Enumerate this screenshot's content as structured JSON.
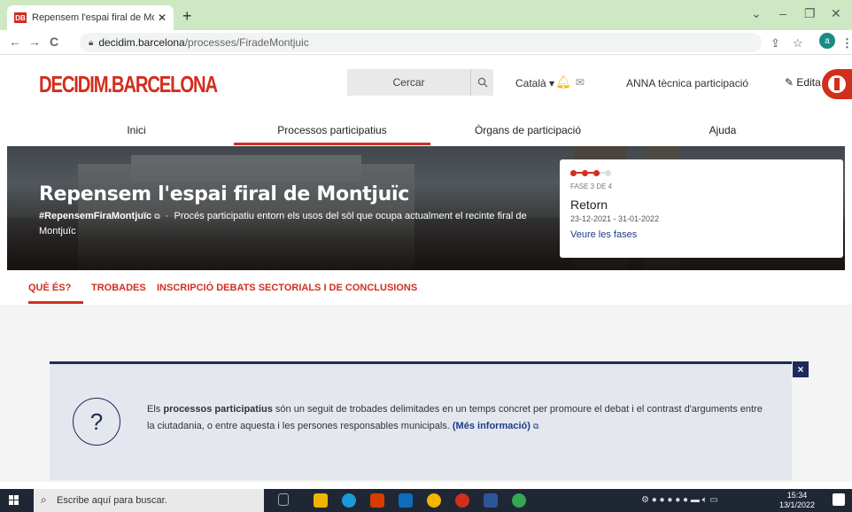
{
  "browser": {
    "tab_title": "Repensem l'espai firal de Montju",
    "tab_favicon": "DB",
    "url_host": "decidim.barcelona",
    "url_path": "/processes/FiradeMontjuic",
    "profile_initial": "a"
  },
  "header": {
    "logo": "DECIDIM.BARCELONA",
    "search_placeholder": "Cercar",
    "language": "Català",
    "user": "ANNA tècnica participació",
    "edit_label": "Edita"
  },
  "nav": {
    "items": [
      "Inici",
      "Processos participatius",
      "Òrgans de participació",
      "Ajuda"
    ],
    "active_index": 1
  },
  "hero": {
    "title": "Repensem l'espai firal de Montjuïc",
    "hashtag": "#RepensemFiraMontjuïc",
    "description": "Procés participatiu entorn els usos del sòl que ocupa actualment el recinte firal de Montjuïc"
  },
  "phase": {
    "step": "FASE 3 DE 4",
    "current": 3,
    "total": 4,
    "name": "Retorn",
    "dates": "23-12-2021 - 31-01-2022",
    "link": "Veure les fases"
  },
  "subnav": {
    "items": [
      "QUÈ ÉS?",
      "TROBADES",
      "INSCRIPCIÓ DEBATS SECTORIALS I DE CONCLUSIONS"
    ],
    "active_index": 0
  },
  "info": {
    "text_prefix": "Els",
    "text_bold": "processos participatius",
    "text_rest": "són un seguit de trobades delimitades en un temps concret per promoure el debat i el contrast d'arguments entre la ciutadania, o entre aquesta i les persones responsables municipals.",
    "link": "(Més informació)",
    "icon": "?",
    "close": "×"
  },
  "taskbar": {
    "search_placeholder": "Escribe aquí para buscar.",
    "time": "15:34",
    "date": "13/1/2022"
  },
  "colors": {
    "brand": "#d22e1e",
    "navy": "#1b2a5a",
    "tab_strip": "#cfe8c4"
  }
}
